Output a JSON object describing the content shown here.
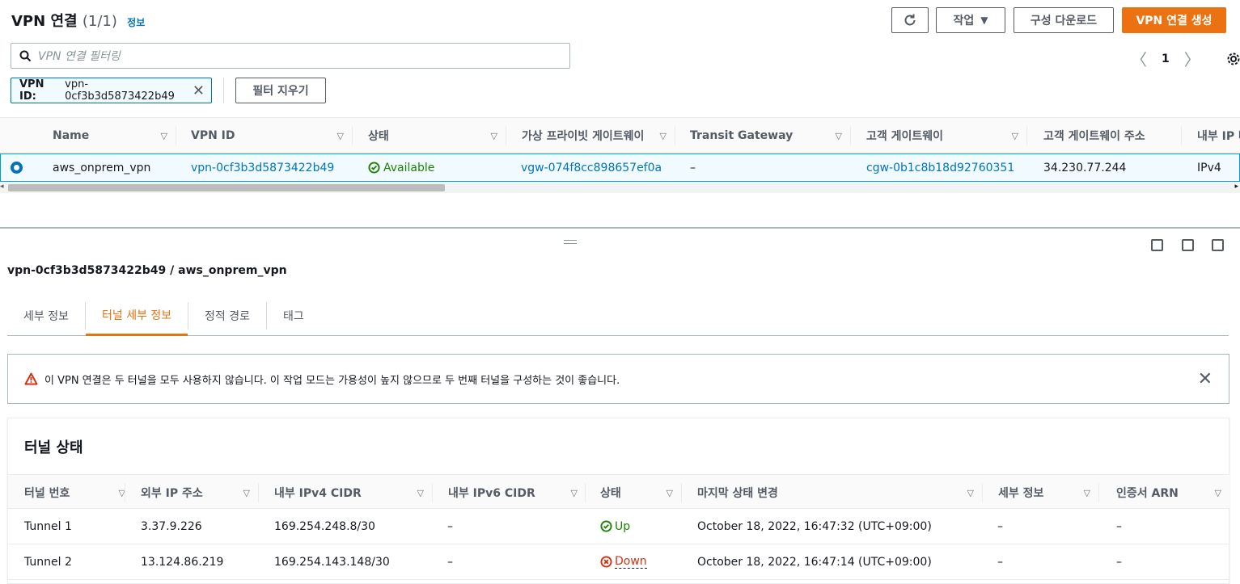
{
  "header": {
    "title": "VPN 연결",
    "count": "(1/1)",
    "info_link": "정보",
    "refresh_icon": "refresh-icon",
    "actions_label": "작업",
    "download_label": "구성 다운로드",
    "create_label": "VPN 연결 생성"
  },
  "filter": {
    "placeholder": "VPN 연결 필터링",
    "token_key": "VPN ID:",
    "token_value": "vpn-0cf3b3d5873422b49",
    "clear_label": "필터 지우기"
  },
  "pagination": {
    "page": "1"
  },
  "table": {
    "columns": [
      "Name",
      "VPN ID",
      "상태",
      "가상 프라이빗 게이트웨이",
      "Transit Gateway",
      "고객 게이트웨이",
      "고객 게이트웨이 주소",
      "내부 IP 버"
    ],
    "row": {
      "name": "aws_onprem_vpn",
      "vpn_id": "vpn-0cf3b3d5873422b49",
      "status": "Available",
      "vgw": "vgw-074f8cc898657ef0a",
      "tgw": "–",
      "cgw": "cgw-0b1c8b18d92760351",
      "cgw_address": "34.230.77.244",
      "inner_ip": "IPv4"
    }
  },
  "detail": {
    "title": "vpn-0cf3b3d5873422b49 / aws_onprem_vpn",
    "tabs": [
      "세부 정보",
      "터널 세부 정보",
      "정적 경로",
      "태그"
    ],
    "active_tab": 1,
    "alert": "이 VPN 연결은 두 터널을 모두 사용하지 않습니다. 이 작업 모드는 가용성이 높지 않으므로 두 번째 터널을 구성하는 것이 좋습니다.",
    "tunnel_heading": "터널 상태",
    "tunnel_columns": [
      "터널 번호",
      "외부 IP 주소",
      "내부 IPv4 CIDR",
      "내부 IPv6 CIDR",
      "상태",
      "마지막 상태 변경",
      "세부 정보",
      "인증서 ARN"
    ],
    "tunnels": [
      {
        "number": "Tunnel 1",
        "outside_ip": "3.37.9.226",
        "ipv4_cidr": "169.254.248.8/30",
        "ipv6_cidr": "–",
        "status": "Up",
        "last_change": "October 18, 2022, 16:47:32 (UTC+09:00)",
        "details": "–",
        "cert_arn": "–"
      },
      {
        "number": "Tunnel 2",
        "outside_ip": "13.124.86.219",
        "ipv4_cidr": "169.254.143.148/30",
        "ipv6_cidr": "–",
        "status": "Down",
        "last_change": "October 18, 2022, 16:47:14 (UTC+09:00)",
        "details": "–",
        "cert_arn": "–"
      }
    ]
  },
  "colors": {
    "accent": "#ec7211",
    "link": "#0073bb",
    "success": "#1d8102",
    "error": "#d13212"
  }
}
